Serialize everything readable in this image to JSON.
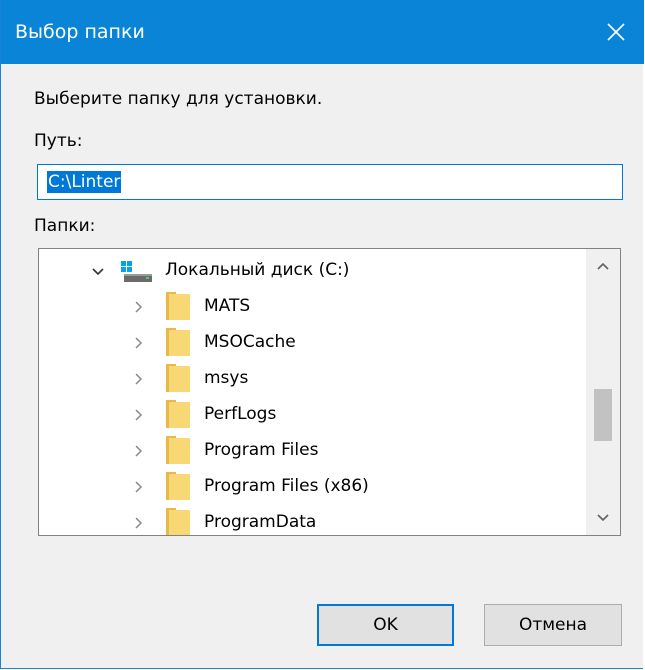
{
  "window": {
    "title": "Выбор папки",
    "close_icon": "close-icon"
  },
  "dialog": {
    "prompt": "Выберите папку для установки.",
    "path_label": "Путь:",
    "path_value": "C:\\Linter",
    "folders_label": "Папки:"
  },
  "tree": {
    "root": {
      "label": "Локальный диск (C:)",
      "icon": "drive-icon",
      "expanded": true
    },
    "items": [
      {
        "label": "MATS",
        "icon": "folder-icon"
      },
      {
        "label": "MSOCache",
        "icon": "folder-icon"
      },
      {
        "label": "msys",
        "icon": "folder-icon"
      },
      {
        "label": "PerfLogs",
        "icon": "folder-icon"
      },
      {
        "label": "Program Files",
        "icon": "folder-icon"
      },
      {
        "label": "Program Files (x86)",
        "icon": "folder-icon"
      },
      {
        "label": "ProgramData",
        "icon": "folder-icon"
      }
    ]
  },
  "buttons": {
    "ok": "OK",
    "cancel": "Отмена"
  },
  "colors": {
    "titlebar": "#0a84d6",
    "accent": "#0078d7",
    "folder": "#f8d775"
  }
}
